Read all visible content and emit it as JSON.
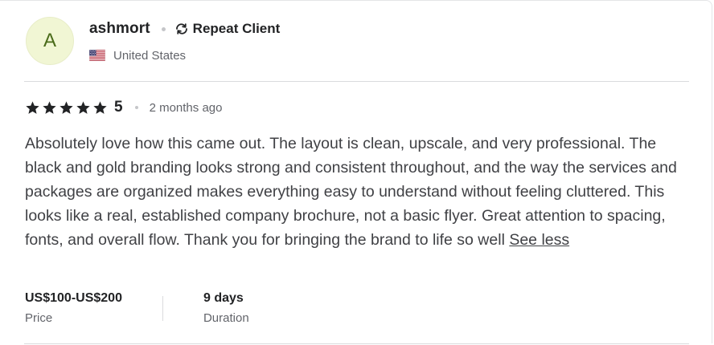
{
  "review": {
    "avatar_initial": "A",
    "username": "ashmort",
    "repeat_client_label": "Repeat Client",
    "country": "United States",
    "rating_value": "5",
    "stars_filled": 5,
    "time_ago": "2 months ago",
    "text": "Absolutely love how this came out. The layout is clean, upscale, and very professional. The black and gold branding looks strong and consistent throughout, and the way the services and packages are organized makes everything easy to understand without feeling cluttered. This looks like a real, established company brochure, not a basic flyer. Great attention to spacing, fonts, and overall flow. Thank you for bringing the brand to life so well",
    "see_less_label": "See less",
    "price": {
      "value": "US$100-US$200",
      "label": "Price"
    },
    "duration": {
      "value": "9 days",
      "label": "Duration"
    }
  },
  "icons": {
    "repeat": "repeat-icon",
    "flag": "us-flag-icon",
    "star": "star-icon"
  },
  "colors": {
    "avatar_bg": "#f1f6d4",
    "avatar_text": "#4a6b1a",
    "primary_text": "#222325",
    "secondary_text": "#62646a",
    "body_text": "#404145",
    "divider": "#dadbdd"
  }
}
